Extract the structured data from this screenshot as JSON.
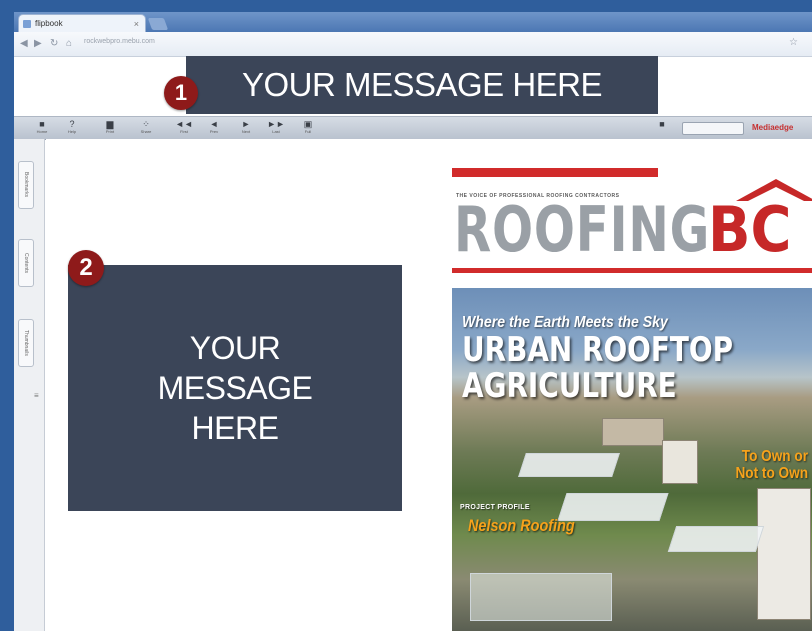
{
  "colors": {
    "frame": "#2f5e9c",
    "banner_bg": "#3b4558",
    "badge_bg": "#8e1a1a",
    "logo_red": "#c62828",
    "logo_grey": "#9aa0a6",
    "callout_orange": "#f6a21b"
  },
  "browser": {
    "tab_title": "flipbook",
    "url": "rockwebpro.mebu.com",
    "icons": [
      "back-icon",
      "forward-icon",
      "reload-icon",
      "home-icon",
      "star-icon"
    ]
  },
  "callouts": {
    "badge1": "1",
    "banner1": "YOUR MESSAGE HERE",
    "badge2": "2",
    "box2_lines": [
      "YOUR",
      "MESSAGE",
      "HERE"
    ]
  },
  "toolbar": {
    "tools": [
      {
        "icon": "home-icon",
        "label": "Home"
      },
      {
        "icon": "help-icon",
        "label": "Help"
      },
      {
        "icon": "print-icon",
        "label": "Print"
      },
      {
        "icon": "share-icon",
        "label": "Share"
      },
      {
        "icon": "first-page-icon",
        "label": "First"
      },
      {
        "icon": "prev-page-icon",
        "label": "Prev"
      },
      {
        "icon": "next-page-icon",
        "label": "Next"
      },
      {
        "icon": "last-page-icon",
        "label": "Last"
      },
      {
        "icon": "fullscreen-icon",
        "label": "Full"
      }
    ],
    "brand": "Mediaedge"
  },
  "siderail": {
    "tabs": [
      "Bookmarks",
      "Contents",
      "Thumbnails"
    ]
  },
  "cover": {
    "tagline": "THE VOICE OF PROFESSIONAL ROOFING CONTRACTORS",
    "logo_left": "ROOFING",
    "logo_right": "BC",
    "headline_small": "Where the Earth Meets the Sky",
    "headline_big_1": "URBAN ROOFTOP",
    "headline_big_2": "AGRICULTURE",
    "callout_line1": "To Own or",
    "callout_line2": "Not to Own",
    "profile_label": "PROJECT PROFILE",
    "profile_name": "Nelson Roofing"
  }
}
